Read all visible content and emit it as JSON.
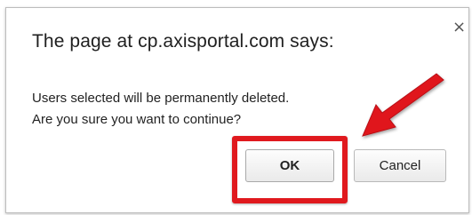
{
  "dialog": {
    "title": "The page at cp.axisportal.com says:",
    "close_label": "×",
    "message_lines": [
      "Users selected will be permanently deleted.",
      "Are you sure you want to continue?"
    ],
    "ok_label": "OK",
    "cancel_label": "Cancel"
  },
  "annotation": {
    "highlight_color": "#e0191e",
    "arrow_color": "#e0191e",
    "highlight_target": "ok-button"
  }
}
